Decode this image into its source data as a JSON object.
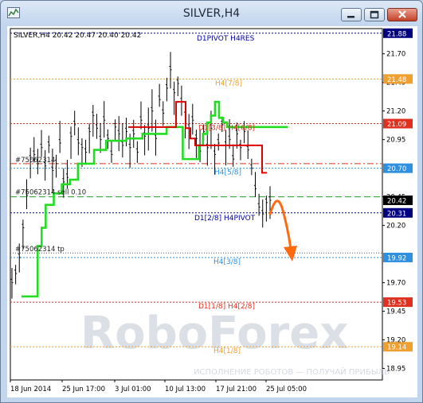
{
  "window": {
    "title": "SILVER,H4"
  },
  "chart_data": {
    "type": "line",
    "symbol_info": "SILVER,H4  20.42 20.47 20.40 20.42",
    "ylim": [
      18.85,
      21.92
    ],
    "y_ticks": [
      "21.70",
      "21.45",
      "21.20",
      "20.95",
      "20.45",
      "20.20",
      "19.70",
      "19.45",
      "19.20",
      "18.95"
    ],
    "x_ticks": [
      "18 Jun 2014",
      "25 Jun 17:00",
      "3 Jul 01:00",
      "10 Jul 13:00",
      "17 Jul 21:00",
      "25 Jul 05:00"
    ],
    "levels": [
      {
        "label": "D1PIVOT H4RES",
        "value": 21.88,
        "color": "#0000a0",
        "dash": "2,2",
        "price": "21.88",
        "tag": "#000080"
      },
      {
        "label": "H4[7/8]",
        "value": 21.48,
        "color": "#f0a030",
        "dash": "2,2",
        "price": "21.48",
        "tag": "#f0a030"
      },
      {
        "label": "D1[3/8] H4[6/8]",
        "value": 21.09,
        "color": "#e03020",
        "dash": "2,2",
        "price": "21.09",
        "tag": "#e03020"
      },
      {
        "label": "H4[5/8]",
        "value": 20.7,
        "color": "#3090e0",
        "dash": "2,2",
        "price": "20.70",
        "tag": "#3090e0"
      },
      {
        "label": "D1[2/8] H4PIVOT",
        "value": 20.31,
        "color": "#0000a0",
        "dash": "2,2",
        "price": "20.31",
        "tag": "#000080"
      },
      {
        "label": "H4[3/8]",
        "value": 19.92,
        "color": "#3090e0",
        "dash": "2,2",
        "price": "19.92",
        "tag": "#3090e0"
      },
      {
        "label": "D1[1/8] H4[2/8]",
        "value": 19.53,
        "color": "#e03020",
        "dash": "2,2",
        "price": "19.53",
        "tag": "#e03020"
      },
      {
        "label": "H4[1/8]",
        "value": 19.14,
        "color": "#f0a030",
        "dash": "2,2",
        "price": "19.14",
        "tag": "#f0a030"
      }
    ],
    "orders": [
      {
        "label": "#75062314",
        "value": 20.74,
        "color": "#e03020",
        "dash": "8,3,2,3"
      },
      {
        "label": "#75062314 sell 0.10",
        "value": 20.45,
        "color": "#20a020",
        "dash": "8,4"
      },
      {
        "label": "#75062314 tp",
        "value": 19.96,
        "color": "#505050",
        "dash": "1,2"
      }
    ],
    "current_price": {
      "value": 20.42,
      "price": "20.42",
      "tag": "#000000"
    },
    "series": [
      {
        "color": "#000000",
        "values": [
          19.7,
          19.78,
          19.92,
          20.18,
          20.46,
          20.78,
          20.82,
          20.74,
          20.88,
          20.72,
          20.9,
          20.68,
          20.74,
          20.92,
          20.58,
          20.62,
          20.98,
          21.08,
          20.92,
          20.88,
          20.84,
          21.02,
          21.16,
          21.05,
          20.95,
          21.12,
          20.96,
          20.82,
          21.06,
          21.0,
          20.9,
          21.02,
          20.88,
          21.0,
          20.84,
          21.12,
          20.98,
          21.05,
          21.2,
          20.96,
          21.3,
          21.18,
          21.4,
          21.56,
          21.36,
          21.44,
          21.28,
          21.16,
          21.05,
          21.12,
          20.96,
          20.85,
          21.02,
          20.88,
          21.05,
          20.82,
          20.92,
          21.08,
          20.9,
          20.95,
          20.78,
          21.0,
          20.88,
          21.02,
          20.86,
          20.7,
          20.52,
          20.36,
          20.3,
          20.4,
          20.42
        ]
      },
      {
        "color": "#22dd22",
        "values": [
          19.58,
          19.58,
          19.58,
          19.58,
          20.02,
          20.18,
          20.38,
          20.38,
          20.48,
          20.48,
          20.56,
          20.56,
          20.6,
          20.6,
          20.74,
          20.74,
          20.74,
          20.74,
          20.86,
          20.86,
          20.86,
          20.94,
          20.94,
          20.94,
          20.94,
          20.94,
          20.96,
          20.96,
          20.96,
          20.96,
          21.0,
          21.0,
          21.0,
          21.0,
          21.0,
          21.0,
          21.06,
          21.06,
          21.06,
          21.06,
          20.78,
          20.78,
          20.78,
          20.78,
          20.9,
          21.0,
          21.1,
          21.16,
          21.28,
          21.14,
          21.1,
          21.06,
          21.06,
          21.06,
          21.06,
          21.06,
          21.06,
          21.06,
          21.06,
          21.06,
          21.06,
          21.06,
          21.06,
          21.06,
          21.06,
          21.06,
          21.06
        ]
      },
      {
        "color": "#dd0000",
        "values": [
          21.06,
          21.06,
          21.06,
          21.06,
          21.06,
          21.06,
          21.06,
          21.06,
          21.06,
          21.06,
          21.28,
          21.28,
          21.05,
          20.96,
          20.9,
          20.9,
          20.9,
          20.9,
          20.9,
          20.9,
          20.9,
          20.9,
          20.9,
          20.9,
          20.9,
          20.9,
          20.9,
          20.9,
          20.66,
          20.66
        ]
      }
    ],
    "forecast_arrow": {
      "color": "#ff6a10"
    },
    "watermark": "RoboForex",
    "watermark_sub": "ИСПОЛНЕНИЕ РОБОТОВ — ПОЛУЧАЙ ПРИБЫЛЬ"
  }
}
